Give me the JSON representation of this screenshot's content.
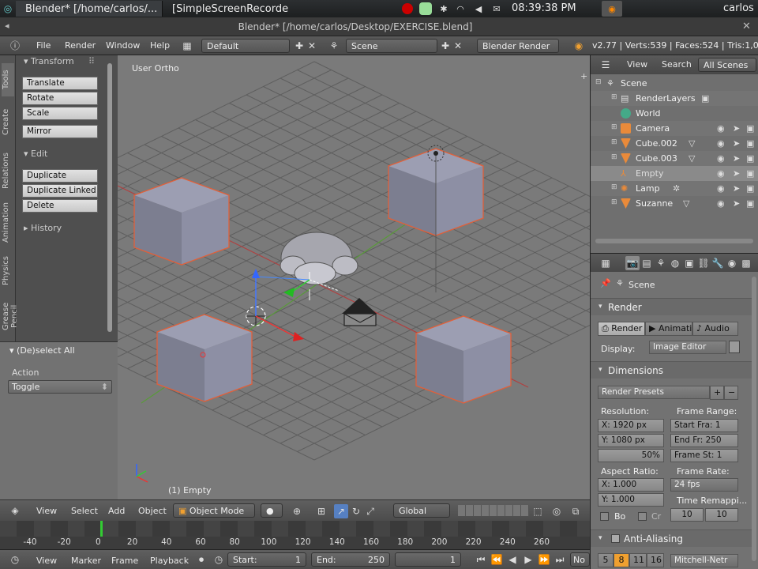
{
  "taskbar": {
    "task1": "Blender* [/home/carlos/...",
    "task2": "[SimpleScreenRecorder]",
    "clock": "08:39:38 PM",
    "user": "carlos"
  },
  "window": {
    "title": "Blender* [/home/carlos/Desktop/EXERCISE.blend]"
  },
  "infobar": {
    "menus": [
      "File",
      "Render",
      "Window",
      "Help"
    ],
    "layout": "Default",
    "scene": "Scene",
    "engine": "Blender Render",
    "stats": "v2.77 | Verts:539 | Faces:524 | Tris:1,016 | O"
  },
  "toolshelf": {
    "tabs": [
      "Tools",
      "Create",
      "Relations",
      "Animation",
      "Physics",
      "Grease Pencil"
    ],
    "transform_header": "Transform",
    "transform_buttons": [
      "Translate",
      "Rotate",
      "Scale"
    ],
    "mirror": "Mirror",
    "edit_header": "Edit",
    "edit_buttons": [
      "Duplicate",
      "Duplicate Linked",
      "Delete"
    ],
    "history_header": "History"
  },
  "operator_panel": {
    "title": "(De)select All",
    "action_label": "Action",
    "action_value": "Toggle"
  },
  "viewport": {
    "view_label": "User Ortho",
    "object_label": "(1) Empty"
  },
  "view_header": {
    "menus": [
      "View",
      "Select",
      "Add",
      "Object"
    ],
    "mode": "Object Mode",
    "orientation": "Global"
  },
  "timeline": {
    "ticks": [
      "-40",
      "-20",
      "0",
      "20",
      "40",
      "60",
      "80",
      "100",
      "120",
      "140",
      "160",
      "180",
      "200",
      "220",
      "240",
      "260"
    ],
    "menus": [
      "View",
      "Marker",
      "Frame",
      "Playback"
    ],
    "start_label": "Start:",
    "start_value": "1",
    "end_label": "End:",
    "end_value": "250",
    "current_frame": "1",
    "no_sync": "No"
  },
  "outliner": {
    "menus": [
      "View",
      "Search"
    ],
    "filter": "All Scenes",
    "items": [
      {
        "label": "Scene"
      },
      {
        "label": "RenderLayers"
      },
      {
        "label": "World"
      },
      {
        "label": "Camera"
      },
      {
        "label": "Cube.002"
      },
      {
        "label": "Cube.003"
      },
      {
        "label": "Empty"
      },
      {
        "label": "Lamp"
      },
      {
        "label": "Suzanne"
      }
    ]
  },
  "properties": {
    "context": "Scene",
    "render_section": "Render",
    "render_tabs": [
      "Render",
      "Animatio",
      "Audio"
    ],
    "display_label": "Display:",
    "display_value": "Image Editor",
    "dimensions_section": "Dimensions",
    "render_presets": "Render Presets",
    "resolution_label": "Resolution:",
    "res_x": "X:  1920 px",
    "res_y": "Y:  1080 px",
    "res_pct": "50%",
    "frame_range_label": "Frame Range:",
    "start_frame": "Start Fra:  1",
    "end_frame": "End Fr:  250",
    "frame_step": "Frame St:  1",
    "aspect_label": "Aspect Ratio:",
    "aspect_x": "X:      1.000",
    "aspect_y": "Y:      1.000",
    "frame_rate_label": "Frame Rate:",
    "fps": "24 fps",
    "time_remap_label": "Time Remappi...",
    "remap_old": "10",
    "remap_new": "10",
    "border_label": "Bo",
    "crop_label": "Cr",
    "aa_section": "Anti-Aliasing",
    "aa_samples": [
      "5",
      "8",
      "11",
      "16"
    ],
    "aa_filter": "Mitchell-Netr"
  },
  "colors": {
    "viewport_bg": "#7a7a7a",
    "selection_outline": "#e0603a",
    "accent_orange": "#f0a030"
  }
}
